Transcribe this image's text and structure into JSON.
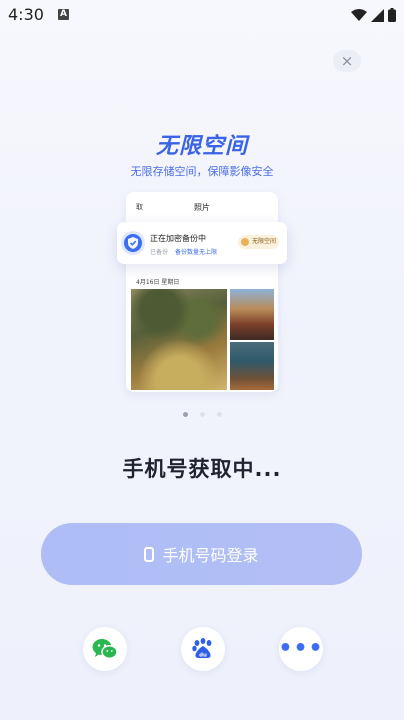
{
  "status_bar": {
    "time": "4:30",
    "notification_icon": "A"
  },
  "close": {
    "label": "×"
  },
  "hero": {
    "title": "无限空间",
    "subtitle": "无限存储空间，保障影像安全"
  },
  "preview": {
    "header_left": "取",
    "header_title": "照片",
    "date": "4月16日 星期日",
    "backup_title": "正在加密备份中",
    "backup_sub": "已备份",
    "backup_sub2": "备份数量无上限",
    "badge": "无限空间"
  },
  "pagination": {
    "count": 3,
    "active": 0
  },
  "status_message": "手机号获取中...",
  "login": {
    "phone_button": "手机号码登录"
  },
  "social": {
    "wechat_icon": "wechat-icon",
    "baidu_icon": "baidu-icon",
    "more_label": "•••"
  },
  "colors": {
    "accent": "#3b63e6",
    "button": "#aebdf6",
    "background": "#f4f6fd"
  }
}
